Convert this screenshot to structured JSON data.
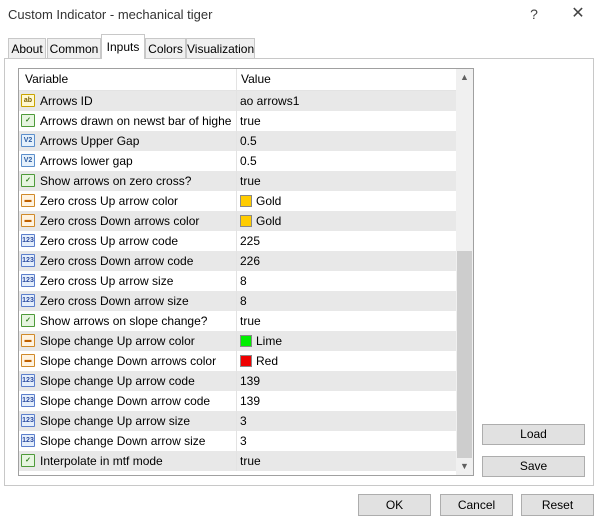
{
  "window": {
    "title": "Custom Indicator - mechanical tiger",
    "help_glyph": "?",
    "close_glyph": "✕"
  },
  "tabs": [
    "About",
    "Common",
    "Inputs",
    "Colors",
    "Visualization"
  ],
  "active_tab": "Inputs",
  "grid": {
    "header_variable": "Variable",
    "header_value": "Value",
    "rows": [
      {
        "icon": "ab",
        "name": "Arrows ID",
        "value": "ao arrows1"
      },
      {
        "icon": "bool",
        "name": "Arrows drawn on newst bar of higher ti...",
        "value": "true"
      },
      {
        "icon": "V2",
        "name": "Arrows Upper Gap",
        "value": "0.5"
      },
      {
        "icon": "V2",
        "name": "Arrows lower gap",
        "value": "0.5"
      },
      {
        "icon": "bool",
        "name": "Show arrows on zero cross?",
        "value": "true"
      },
      {
        "icon": "color",
        "name": "Zero cross Up arrow color",
        "value": "Gold",
        "color": "#ffcc00"
      },
      {
        "icon": "color",
        "name": "Zero cross Down arrows color",
        "value": "Gold",
        "color": "#ffcc00"
      },
      {
        "icon": "123",
        "name": "Zero cross Up arrow code",
        "value": "225"
      },
      {
        "icon": "123",
        "name": "Zero cross Down arrow code",
        "value": "226"
      },
      {
        "icon": "123",
        "name": "Zero cross Up arrow size",
        "value": "8"
      },
      {
        "icon": "123",
        "name": "Zero cross Down arrow size",
        "value": "8"
      },
      {
        "icon": "bool",
        "name": "Show arrows on slope change?",
        "value": "true"
      },
      {
        "icon": "color",
        "name": "Slope change Up arrow color",
        "value": "Lime",
        "color": "#00ee00"
      },
      {
        "icon": "color",
        "name": "Slope change Down arrows color",
        "value": "Red",
        "color": "#ee0000"
      },
      {
        "icon": "123",
        "name": "Slope change Up arrow code",
        "value": "139"
      },
      {
        "icon": "123",
        "name": "Slope change Down arrow code",
        "value": "139"
      },
      {
        "icon": "123",
        "name": "Slope change Up arrow size",
        "value": "3"
      },
      {
        "icon": "123",
        "name": "Slope change Down arrow size",
        "value": "3"
      },
      {
        "icon": "bool",
        "name": "Interpolate in mtf mode",
        "value": "true"
      }
    ]
  },
  "buttons": {
    "load": "Load",
    "save": "Save",
    "ok": "OK",
    "cancel": "Cancel",
    "reset": "Reset"
  },
  "scrollbar": {
    "up_glyph": "▲",
    "down_glyph": "▼"
  }
}
